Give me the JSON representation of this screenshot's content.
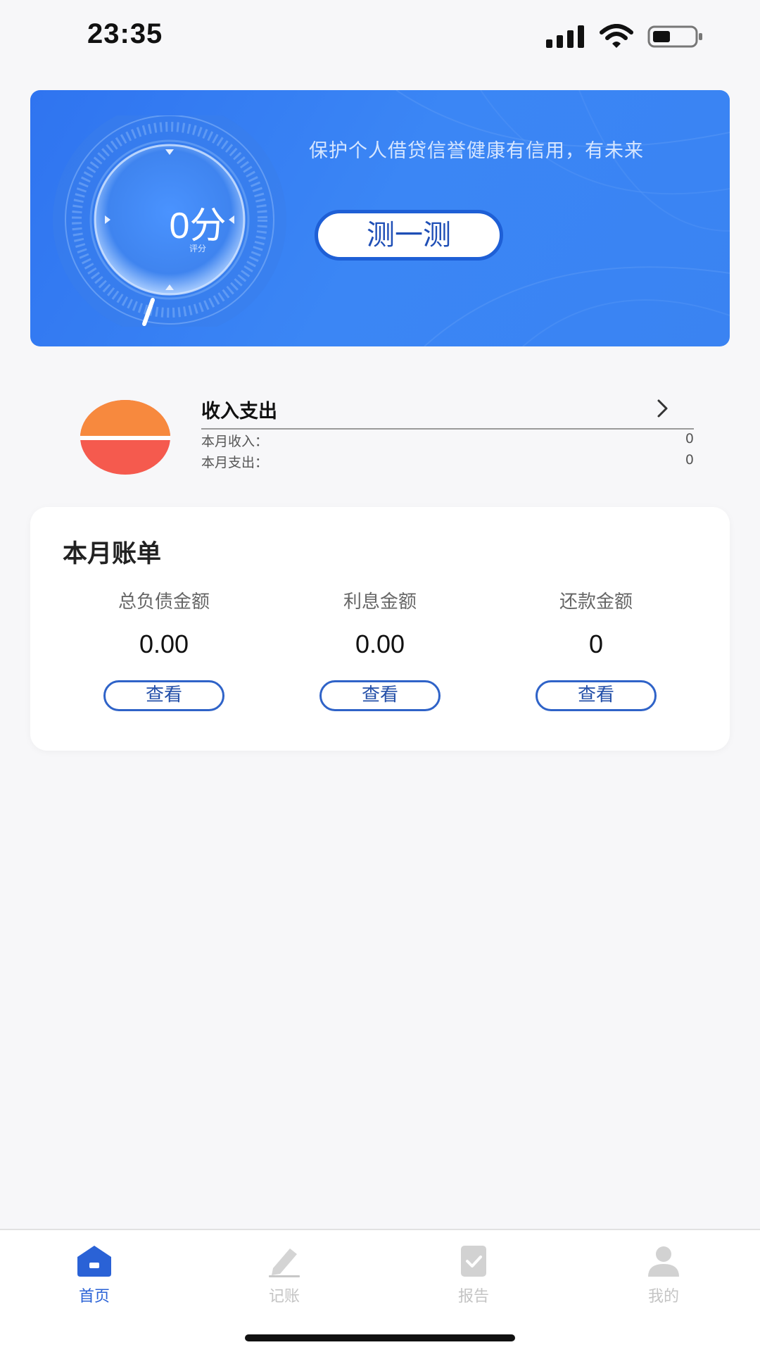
{
  "status_bar": {
    "time": "23:35"
  },
  "hero": {
    "score": "0分",
    "score_caption": "评分",
    "slogan": "保护个人借贷信誉健康有信用，有未来",
    "test_button": "测一测"
  },
  "income_expense": {
    "title": "收入支出",
    "month_income_label": "本月收入：",
    "month_income_value": "0",
    "month_expense_label": "本月支出：",
    "month_expense_value": "0",
    "colors": {
      "income": "#f7893e",
      "expense": "#f55a4e"
    }
  },
  "monthly_bill": {
    "title": "本月账单",
    "columns": [
      {
        "label": "总负债金额",
        "value": "0.00",
        "button": "查看"
      },
      {
        "label": "利息金额",
        "value": "0.00",
        "button": "查看"
      },
      {
        "label": "还款金额",
        "value": "0",
        "button": "查看"
      }
    ]
  },
  "tab_bar": {
    "items": [
      {
        "label": "首页",
        "icon": "home-icon",
        "active": true
      },
      {
        "label": "记账",
        "icon": "pencil-icon",
        "active": false
      },
      {
        "label": "报告",
        "icon": "report-icon",
        "active": false
      },
      {
        "label": "我的",
        "icon": "user-icon",
        "active": false
      }
    ],
    "active_color": "#2a62d6",
    "inactive_color": "#c8c8c8"
  }
}
